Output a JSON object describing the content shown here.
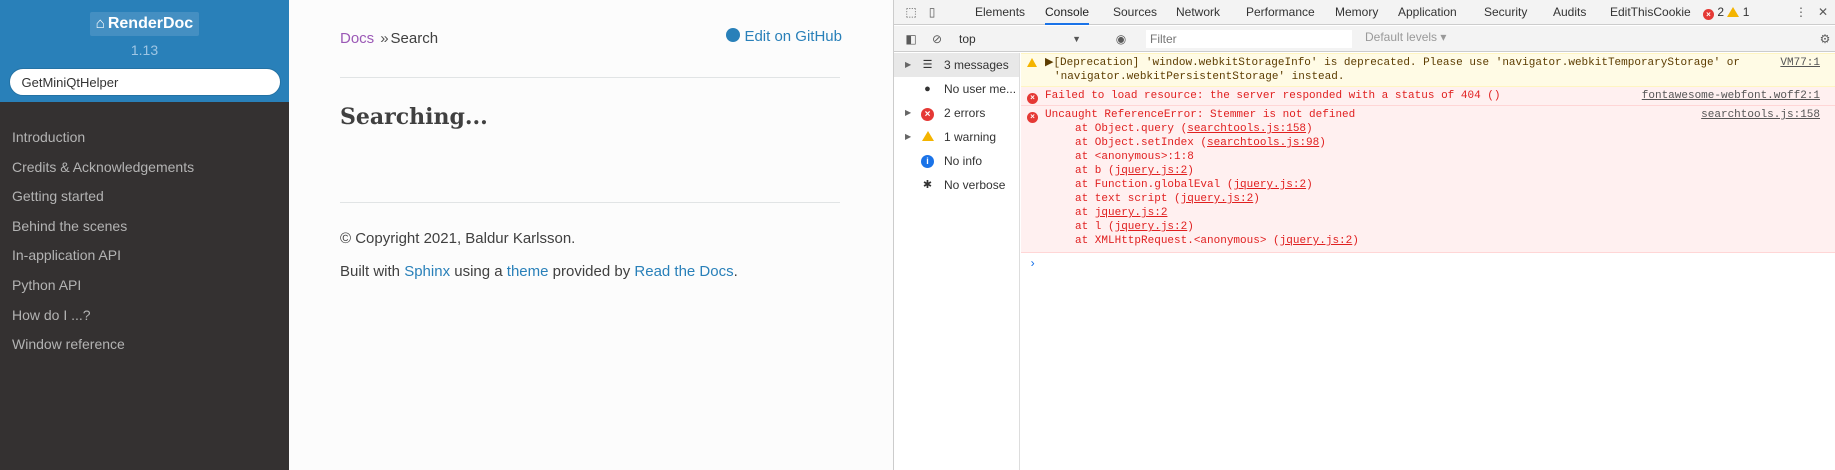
{
  "sidebar": {
    "brand": "RenderDoc",
    "version": "1.13",
    "search_value": "GetMiniQtHelper",
    "nav": [
      "Introduction",
      "Credits & Acknowledgements",
      "Getting started",
      "Behind the scenes",
      "In-application API",
      "Python API",
      "How do I ...?",
      "Window reference"
    ]
  },
  "content": {
    "breadcrumb_docs": "Docs",
    "breadcrumb_sep": "»",
    "breadcrumb_current": "Search",
    "edit_link": "Edit on GitHub",
    "heading": "Searching...",
    "copyright": "© Copyright 2021, Baldur Karlsson.",
    "built_with_pre": "Built with ",
    "sphinx": "Sphinx",
    "using_a": " using a ",
    "theme": "theme",
    "provided_by": " provided by ",
    "rtd": "Read the Docs",
    "period": "."
  },
  "devtools": {
    "tabs": [
      "Elements",
      "Console",
      "Sources",
      "Network",
      "Performance",
      "Memory",
      "Application",
      "Security",
      "Audits",
      "EditThisCookie"
    ],
    "active_tab": "Console",
    "error_count": "2",
    "warning_count": "1",
    "context": "top",
    "filter_placeholder": "Filter",
    "levels": "Default levels",
    "sidebar": [
      {
        "label": "3 messages",
        "icon": "list-icon"
      },
      {
        "label": "No user me...",
        "icon": "user-icon"
      },
      {
        "label": "2 errors",
        "icon": "error-icon"
      },
      {
        "label": "1 warning",
        "icon": "warning-icon"
      },
      {
        "label": "No info",
        "icon": "info-icon"
      },
      {
        "label": "No verbose",
        "icon": "bug-icon"
      }
    ],
    "messages": {
      "warn_line1": "▶[Deprecation] 'window.webkitStorageInfo' is deprecated. Please use 'navigator.webkitTemporaryStorage' or",
      "warn_line2": "'navigator.webkitPersistentStorage' instead.",
      "warn_src": "VM77:1",
      "err1_text": "Failed to load resource: the server responded with a status of 404 ()",
      "err1_src": "fontawesome-webfont.woff2:1",
      "err2_text": "Uncaught ReferenceError: Stemmer is not defined",
      "err2_src": "searchtools.js:158",
      "stack": [
        {
          "pre": "at Object.query (",
          "link": "searchtools.js:158",
          "post": ")"
        },
        {
          "pre": "at Object.setIndex (",
          "link": "searchtools.js:98",
          "post": ")"
        },
        {
          "pre": "at <anonymous>:1:8",
          "link": "",
          "post": ""
        },
        {
          "pre": "at b (",
          "link": "jquery.js:2",
          "post": ")"
        },
        {
          "pre": "at Function.globalEval (",
          "link": "jquery.js:2",
          "post": ")"
        },
        {
          "pre": "at text script (",
          "link": "jquery.js:2",
          "post": ")"
        },
        {
          "pre": "at ",
          "link": "jquery.js:2",
          "post": ""
        },
        {
          "pre": "at l (",
          "link": "jquery.js:2",
          "post": ")"
        },
        {
          "pre": "at XMLHttpRequest.<anonymous> (",
          "link": "jquery.js:2",
          "post": ")"
        }
      ]
    },
    "prompt": "›"
  },
  "colors": {
    "sidebar_blue": "#2980b9",
    "sidebar_dark": "#343131",
    "link": "#2980b9",
    "visited": "#9b59b6",
    "error_red": "#e02020",
    "error_bg": "#fff0f0",
    "warn_bg": "#fffbe5"
  }
}
